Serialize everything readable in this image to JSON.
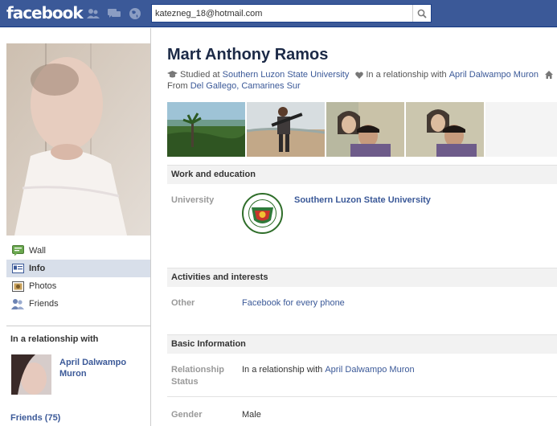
{
  "topbar": {
    "logo": "facebook",
    "search_value": "katezneg_18@hotmail.com"
  },
  "sidebar": {
    "nav": [
      {
        "label": "Wall",
        "icon": "wall-icon"
      },
      {
        "label": "Info",
        "icon": "info-icon",
        "active": true
      },
      {
        "label": "Photos",
        "icon": "photos-icon"
      },
      {
        "label": "Friends",
        "icon": "friends-icon"
      }
    ],
    "relationship_title": "In a relationship with",
    "relationship_name": "April Dalwampo Muron",
    "friends_label": "Friends (75)"
  },
  "profile": {
    "name": "Mart Anthony Ramos",
    "studied_prefix": "Studied at",
    "studied_school": "Southern Luzon State University",
    "relationship_prefix": "In a relationship with",
    "relationship_name": "April Dalwampo Muron",
    "from_prefix": "From",
    "from_place": "Del Gallego, Camarines Sur"
  },
  "sections": {
    "work": {
      "title": "Work and education",
      "label": "University",
      "school": "Southern Luzon State University"
    },
    "activities": {
      "title": "Activities and interests",
      "label": "Other",
      "value": "Facebook for every phone"
    },
    "basic": {
      "title": "Basic Information",
      "relationship_label": "Relationship Status",
      "relationship_prefix": "In a relationship with",
      "relationship_name": "April Dalwampo Muron",
      "gender_label": "Gender",
      "gender_value": "Male"
    }
  },
  "colors": {
    "brand": "#3b5998",
    "link": "#3b5998",
    "section_bg": "#f2f2f2"
  }
}
